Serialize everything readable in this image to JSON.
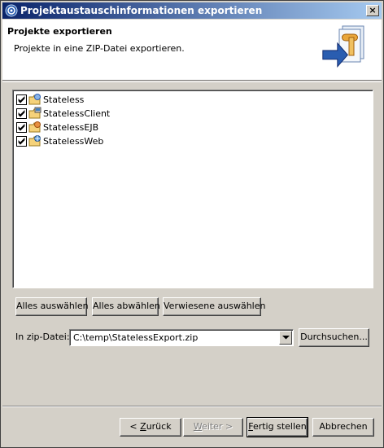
{
  "window": {
    "title": "Projektaustauschinformationen exportieren",
    "close_glyph": "×"
  },
  "header": {
    "title": "Projekte exportieren",
    "description": "Projekte in eine ZIP-Datei exportieren.",
    "graphic_icon": "export-wizard-banner-icon"
  },
  "projects": [
    {
      "label": "Stateless",
      "checked": true,
      "icon": "ear-project-icon"
    },
    {
      "label": "StatelessClient",
      "checked": true,
      "icon": "client-project-icon"
    },
    {
      "label": "StatelessEJB",
      "checked": true,
      "icon": "ejb-project-icon"
    },
    {
      "label": "StatelessWeb",
      "checked": true,
      "icon": "web-project-icon"
    }
  ],
  "selection_buttons": {
    "select_all": "Alles auswählen",
    "deselect_all": "Alles abwählen",
    "select_referenced": "Verwiesene auswählen"
  },
  "zip": {
    "label": "In zip-Datei:",
    "value": "C:\\temp\\StatelessExport.zip",
    "browse": "Durchsuchen..."
  },
  "footer": {
    "back_prefix": "< ",
    "back_mnemonic": "Z",
    "back_rest": "urück",
    "next_mnemonic": "W",
    "next_rest": "eiter >",
    "finish_mnemonic": "F",
    "finish_rest": "ertig stellen",
    "cancel": "Abbrechen"
  },
  "colors": {
    "titlebar_start": "#0a246a",
    "titlebar_end": "#a6caf0",
    "dialog_bg": "#d4d0c8"
  }
}
